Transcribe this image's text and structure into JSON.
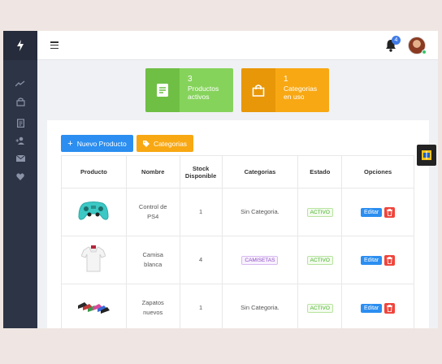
{
  "cards": [
    {
      "number": "3",
      "label_line1": "Productos",
      "label_line2": "activos",
      "icon": "document-icon",
      "color": "#86d35c"
    },
    {
      "number": "1",
      "label_line1": "Categorias",
      "label_line2": "en uso",
      "icon": "shopping-bag-icon",
      "color": "#f8a813"
    }
  ],
  "header": {
    "notification_count": "4"
  },
  "actions": {
    "new_product": "Nuevo Producto",
    "categories": "Categorias"
  },
  "table": {
    "headers": {
      "producto": "Producto",
      "nombre": "Nombre",
      "stock_line1": "Stock",
      "stock_line2": "Disponible",
      "categorias": "Categorias",
      "estado": "Estado",
      "opciones": "Opciones"
    },
    "rows": [
      {
        "name_line1": "Control de",
        "name_line2": "PS4",
        "stock": "1",
        "category": "Sin Categoria.",
        "status": "ACTIVO",
        "edit": "Editar"
      },
      {
        "name_line1": "Camisa",
        "name_line2": "blanca",
        "stock": "4",
        "category": "CAMISETAS",
        "status": "ACTIVO",
        "edit": "Editar"
      },
      {
        "name_line1": "Zapatos",
        "name_line2": "nuevos",
        "stock": "1",
        "category": "Sin Categoria.",
        "status": "ACTIVO",
        "edit": "Editar"
      }
    ]
  },
  "colors": {
    "sidebar": "#2d3446",
    "primary": "#2b8ef0",
    "success": "#86d35c",
    "warning": "#f8a813",
    "danger": "#f0453c"
  }
}
